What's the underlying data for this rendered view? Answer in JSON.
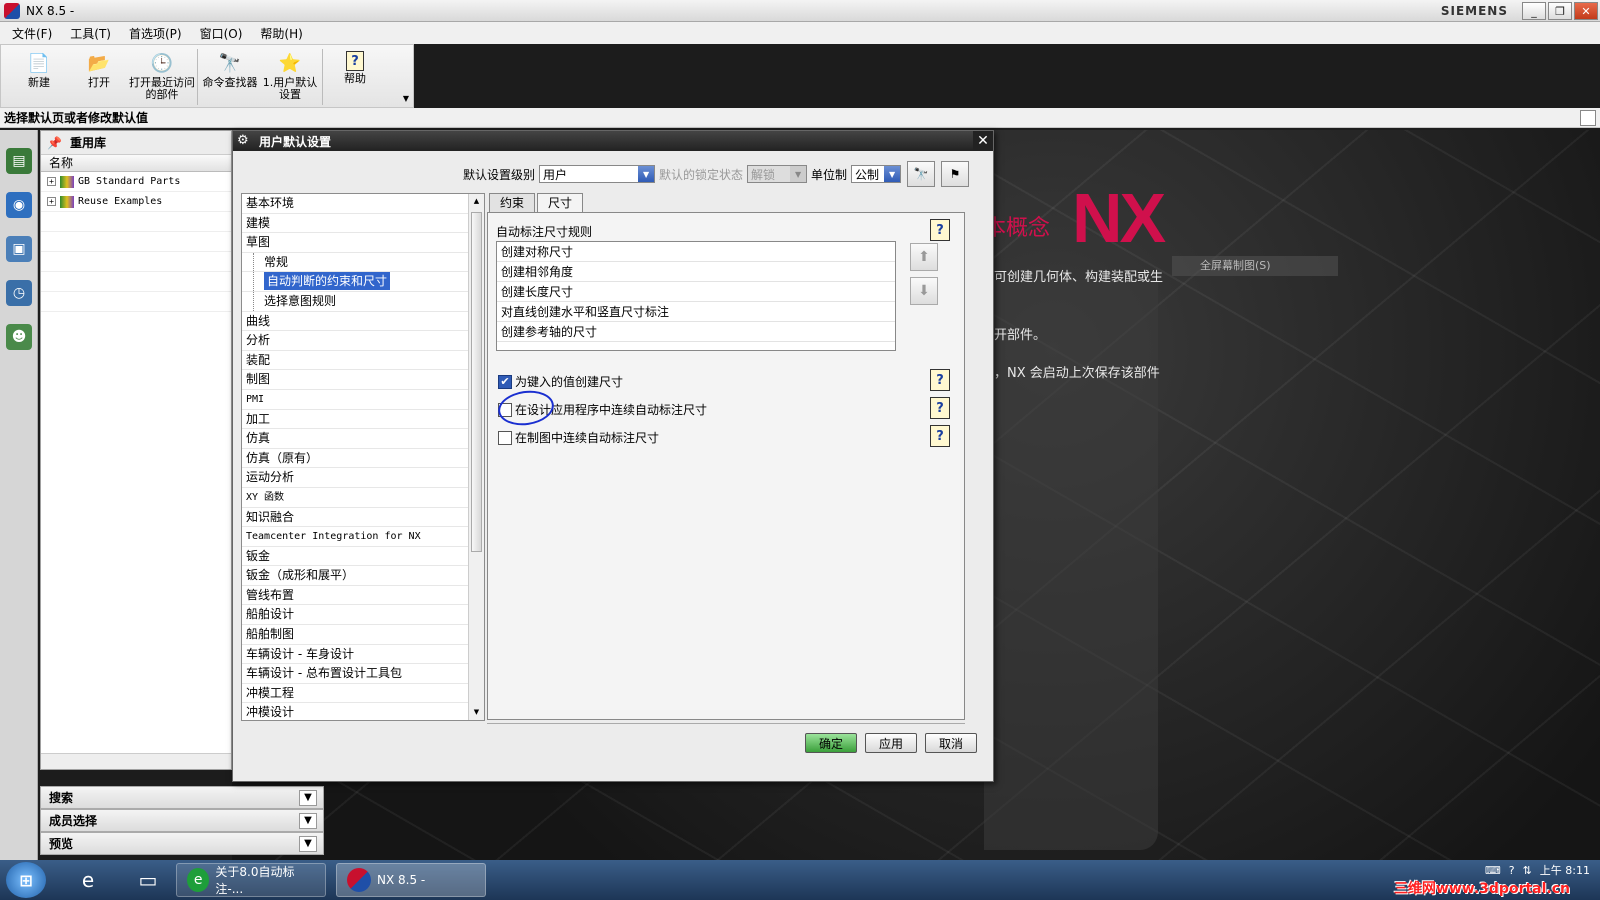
{
  "app": {
    "title": "NX 8.5 -",
    "brand": "SIEMENS"
  },
  "menu": [
    "文件(F)",
    "工具(T)",
    "首选项(P)",
    "窗口(O)",
    "帮助(H)"
  ],
  "toolbar": {
    "new": "新建",
    "open": "打开",
    "recent": "打开最近访问的部件",
    "cmdfinder": "命令查找器",
    "userdefaults": "1.用户默认设置",
    "help": "帮助"
  },
  "cue": "选择默认页或者修改默认值",
  "reuse": {
    "title": "重用库",
    "col_name": "名称",
    "items": [
      "GB Standard Parts",
      "Reuse Examples"
    ]
  },
  "accordion": [
    "搜索",
    "成员选择",
    "预览"
  ],
  "background": {
    "logo": "NX",
    "concept": "本概念",
    "fullscreen_btn": "全屏幕制图(S)",
    "line1": "可创建几何体、构建装配或生",
    "line2": "开部件。",
    "line3": "，NX 会启动上次保存该部件"
  },
  "dialog": {
    "title": "用户默认设置",
    "level_label": "默认设置级别",
    "level_value": "用户",
    "lock_label": "默认的锁定状态",
    "lock_value": "解锁",
    "unit_label": "单位制",
    "unit_value": "公制",
    "categories": [
      {
        "label": "基本环境",
        "type": "top"
      },
      {
        "label": "建模",
        "type": "top"
      },
      {
        "label": "草图",
        "type": "top"
      },
      {
        "label": "常规",
        "type": "sub"
      },
      {
        "label": "自动判断的约束和尺寸",
        "type": "sub",
        "selected": true
      },
      {
        "label": "选择意图规则",
        "type": "sub"
      },
      {
        "label": "曲线",
        "type": "top"
      },
      {
        "label": "分析",
        "type": "top"
      },
      {
        "label": "装配",
        "type": "top"
      },
      {
        "label": "制图",
        "type": "top"
      },
      {
        "label": "PMI",
        "type": "mono"
      },
      {
        "label": "加工",
        "type": "top"
      },
      {
        "label": "仿真",
        "type": "top"
      },
      {
        "label": "仿真（原有）",
        "type": "top"
      },
      {
        "label": "运动分析",
        "type": "top"
      },
      {
        "label": "XY 函数",
        "type": "mono"
      },
      {
        "label": "知识融合",
        "type": "top"
      },
      {
        "label": "Teamcenter Integration for NX",
        "type": "mono"
      },
      {
        "label": "钣金",
        "type": "top"
      },
      {
        "label": "钣金（成形和展平）",
        "type": "top"
      },
      {
        "label": "管线布置",
        "type": "top"
      },
      {
        "label": "船舶设计",
        "type": "top"
      },
      {
        "label": "船舶制图",
        "type": "top"
      },
      {
        "label": "车辆设计 - 车身设计",
        "type": "top"
      },
      {
        "label": "车辆设计 - 总布置设计工具包",
        "type": "top"
      },
      {
        "label": "冲模工程",
        "type": "top"
      },
      {
        "label": "冲模设计",
        "type": "top"
      }
    ],
    "tabs": [
      "约束",
      "尺寸"
    ],
    "active_tab": "尺寸",
    "group_title": "自动标注尺寸规则",
    "rules": [
      "创建对称尺寸",
      "创建相邻角度",
      "创建长度尺寸",
      "对直线创建水平和竖直尺寸标注",
      "创建参考轴的尺寸"
    ],
    "options": [
      {
        "label": "为键入的值创建尺寸",
        "checked": true
      },
      {
        "label": "在设计应用程序中连续自动标注尺寸",
        "checked": false
      },
      {
        "label": "在制图中连续自动标注尺寸",
        "checked": false
      }
    ],
    "ok": "确定",
    "apply": "应用",
    "cancel": "取消"
  },
  "taskbar": {
    "task1": "关于8.0自动标注-...",
    "task2": "NX 8.5 -",
    "time": "上午 8:11",
    "watermark": "三维网www.3dportal.cn"
  }
}
